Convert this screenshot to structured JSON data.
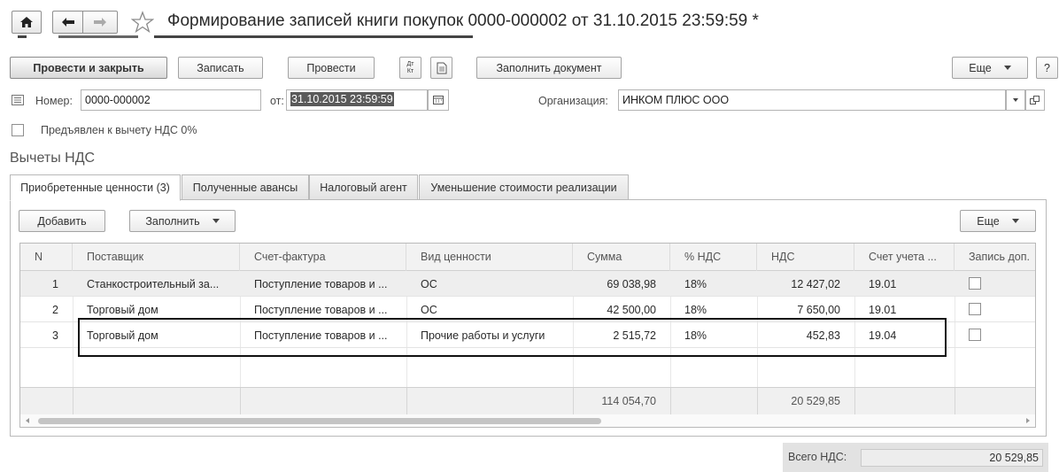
{
  "window": {
    "title": "Формирование записей книги покупок 0000-000002 от 31.10.2015 23:59:59 *"
  },
  "toolbar": {
    "post_close": "Провести и закрыть",
    "save": "Записать",
    "post": "Провести",
    "dtkt": "Дт Кт",
    "fill_doc": "Заполнить документ",
    "more": "Еще",
    "help": "?"
  },
  "header": {
    "number_label": "Номер:",
    "number_value": "0000-000002",
    "date_label": "от:",
    "date_value": "31.10.2015 23:59:59",
    "org_label": "Организация:",
    "org_value": "ИНКОМ ПЛЮС ООО",
    "vat0_label": "Предъявлен к вычету НДС 0%"
  },
  "section_title": "Вычеты НДС",
  "tabs": [
    {
      "label": "Приобретенные ценности (3)",
      "active": true
    },
    {
      "label": "Полученные авансы",
      "active": false
    },
    {
      "label": "Налоговый агент",
      "active": false
    },
    {
      "label": "Уменьшение стоимости реализации",
      "active": false
    }
  ],
  "tab_toolbar": {
    "add": "Добавить",
    "fill": "Заполнить",
    "more": "Еще"
  },
  "table": {
    "columns": [
      "N",
      "Поставщик",
      "Счет-фактура",
      "Вид ценности",
      "Сумма",
      "% НДС",
      "НДС",
      "Счет учета ...",
      "Запись доп."
    ],
    "rows": [
      {
        "n": "1",
        "supplier": "Станкостроительный за...",
        "invoice": "Поступление товаров и ...",
        "kind": "ОС",
        "sum": "69 038,98",
        "rate": "18%",
        "vat": "12 427,02",
        "account": "19.01"
      },
      {
        "n": "2",
        "supplier": "Торговый дом",
        "invoice": "Поступление товаров и ...",
        "kind": "ОС",
        "sum": "42 500,00",
        "rate": "18%",
        "vat": "7 650,00",
        "account": "19.01"
      },
      {
        "n": "3",
        "supplier": "Торговый дом",
        "invoice": "Поступление товаров и ...",
        "kind": "Прочие работы и услуги",
        "sum": "2 515,72",
        "rate": "18%",
        "vat": "452,83",
        "account": "19.04"
      }
    ],
    "totals": {
      "sum": "114 054,70",
      "vat": "20 529,85"
    }
  },
  "total": {
    "label": "Всего НДС:",
    "value": "20 529,85"
  },
  "colors": {
    "selected_row": "#eeeeee",
    "highlight_border": "#111111"
  }
}
